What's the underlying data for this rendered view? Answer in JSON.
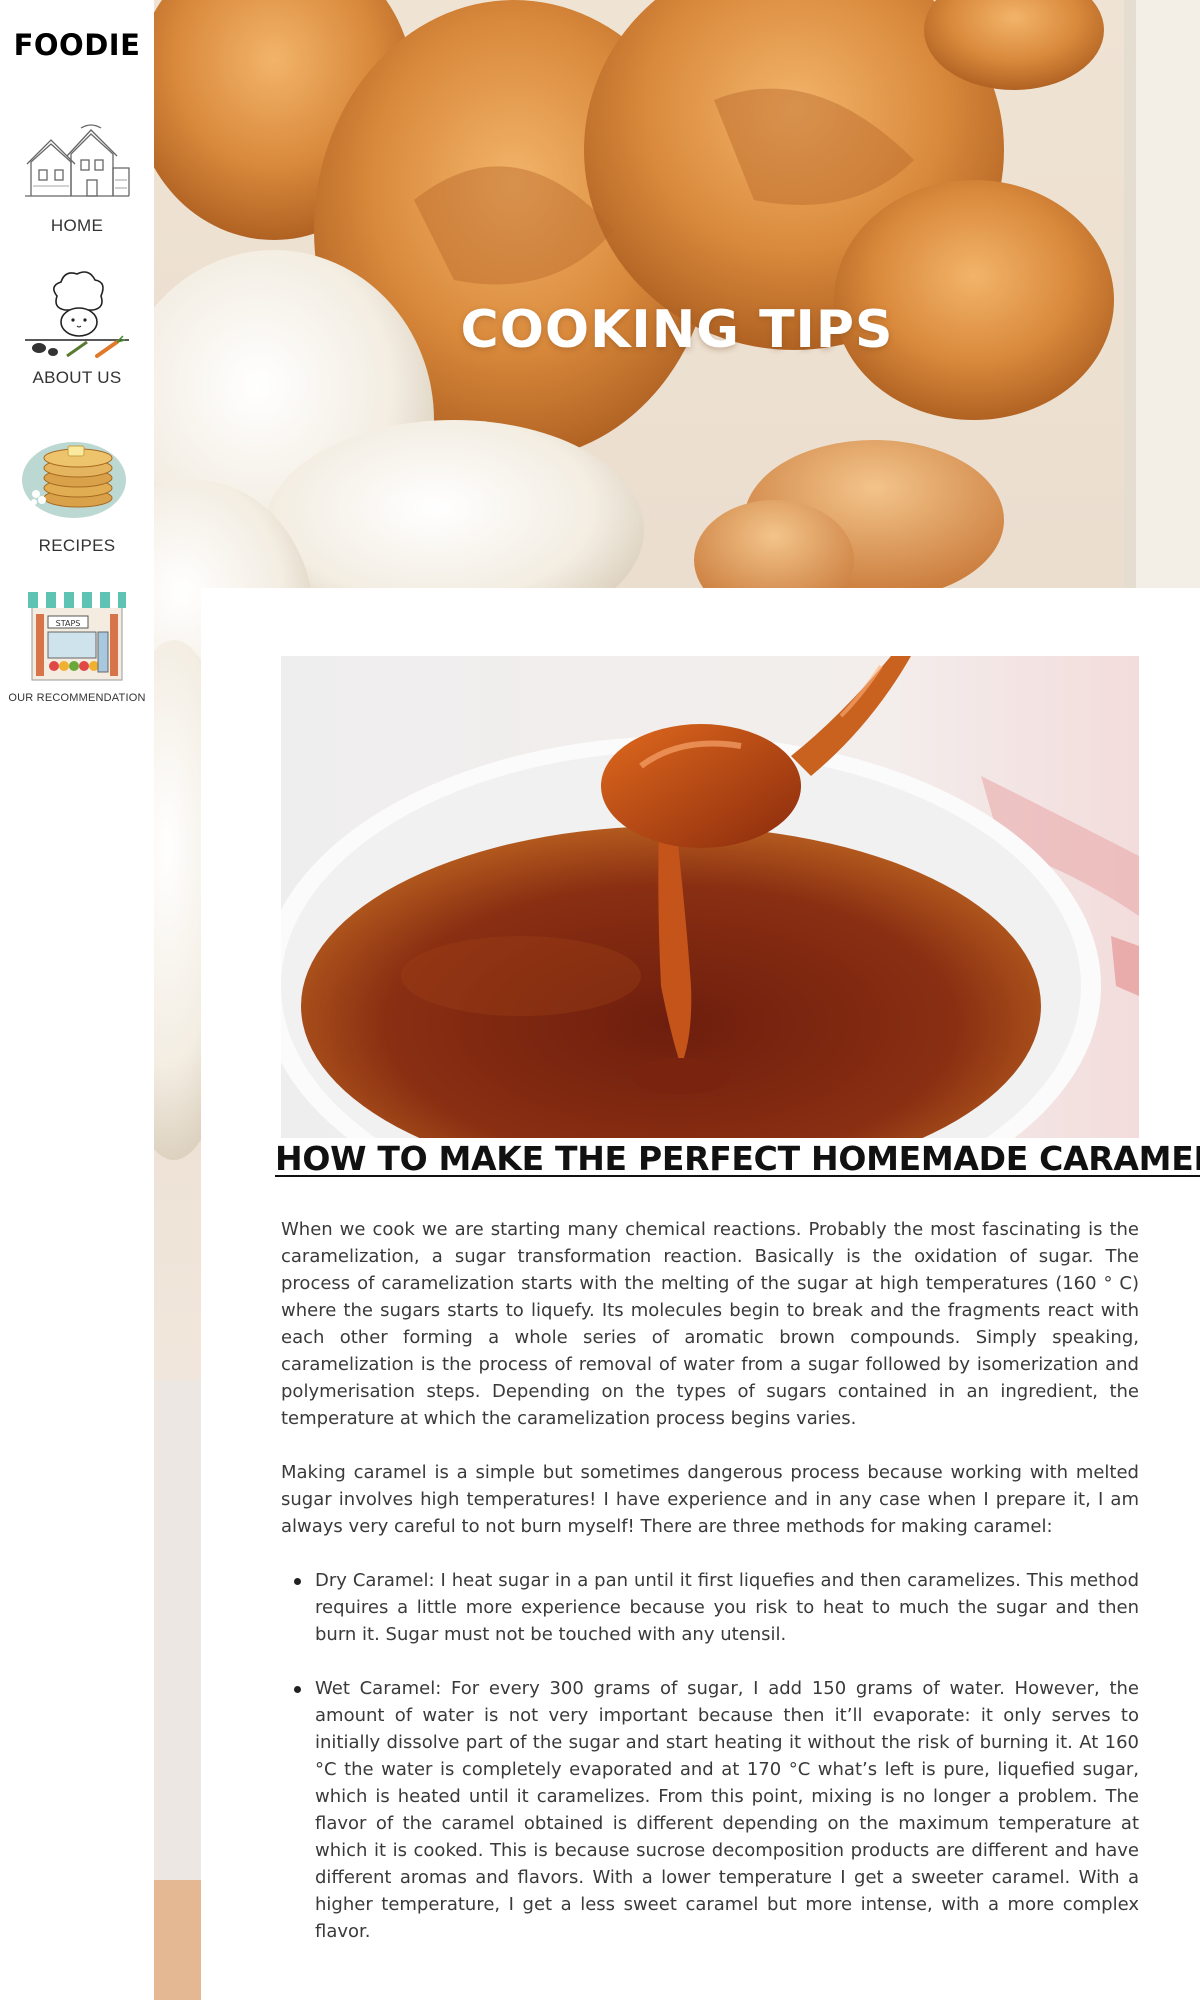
{
  "brand": {
    "logo": "FOODIE"
  },
  "sidebar": {
    "items": [
      {
        "label": "HOME",
        "icon": "house-illustration-icon"
      },
      {
        "label": "ABOUT US",
        "icon": "chef-illustration-icon"
      },
      {
        "label": "RECIPES",
        "icon": "pancakes-illustration-icon"
      },
      {
        "label": "OUR RECOMMENDATION",
        "icon": "shop-illustration-icon"
      }
    ]
  },
  "hero": {
    "title": "COOKING TIPS"
  },
  "article": {
    "title": "HOW TO MAKE THE PERFECT HOMEMADE CARAMEL",
    "paragraphs": [
      "When we cook we are starting many chemical reactions. Probably the most fascinating is the caramelization, a sugar transformation reaction. Basically is the oxidation of sugar. The process of caramelization starts with the melting of the sugar at high temperatures (160 ° C) where the sugars starts to liquefy. Its molecules begin to break and the fragments react with each other forming a whole series of aromatic brown compounds. Simply speaking, caramelization is the process of removal of water from a sugar followed by isomerization and polymerisation steps. Depending on the types of sugars contained in an ingredient, the temperature at which the caramelization process begins varies.",
      "Making caramel is a simple but sometimes dangerous process because working with melted sugar involves high temperatures! I have experience and in any case when I prepare it, I am always very careful to not burn myself! There are three methods for making caramel:"
    ],
    "methods": [
      "Dry Caramel: I heat sugar in a pan until it first liquefies and then caramelizes. This method requires a little more experience because you risk to heat to much the sugar and then burn it. Sugar must not be touched with any utensil.",
      "Wet Caramel: For every 300 grams of sugar, I add 150 grams of water. However, the amount of water is not very important because then it’ll evaporate: it only serves to initially dissolve part of the sugar and start heating it without the risk of burning it. At 160 °C the water is completely evaporated and at 170 °C what’s left is pure, liquefied sugar, which is heated until it caramelizes. From this point, mixing is no longer a problem. The flavor of the caramel obtained is different depending on the maximum temperature at which it is cooked. This is because sucrose decomposition products are different and have different aromas and flavors. With a lower temperature I get a sweeter caramel. With a higher temperature, I get a less sweet caramel but more intense, with a more complex flavor."
    ]
  },
  "colors": {
    "accent_text": "#111111",
    "caramel": "#9a3a12",
    "pastry": "#d98a3a"
  }
}
